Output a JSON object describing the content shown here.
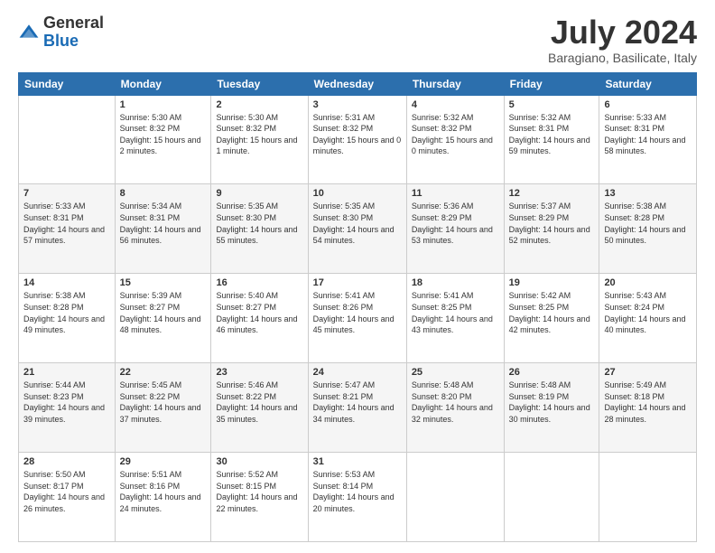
{
  "logo": {
    "general": "General",
    "blue": "Blue"
  },
  "header": {
    "month": "July 2024",
    "location": "Baragiano, Basilicate, Italy"
  },
  "days_of_week": [
    "Sunday",
    "Monday",
    "Tuesday",
    "Wednesday",
    "Thursday",
    "Friday",
    "Saturday"
  ],
  "weeks": [
    [
      {
        "day": "",
        "sunrise": "",
        "sunset": "",
        "daylight": ""
      },
      {
        "day": "1",
        "sunrise": "Sunrise: 5:30 AM",
        "sunset": "Sunset: 8:32 PM",
        "daylight": "Daylight: 15 hours and 2 minutes."
      },
      {
        "day": "2",
        "sunrise": "Sunrise: 5:30 AM",
        "sunset": "Sunset: 8:32 PM",
        "daylight": "Daylight: 15 hours and 1 minute."
      },
      {
        "day": "3",
        "sunrise": "Sunrise: 5:31 AM",
        "sunset": "Sunset: 8:32 PM",
        "daylight": "Daylight: 15 hours and 0 minutes."
      },
      {
        "day": "4",
        "sunrise": "Sunrise: 5:32 AM",
        "sunset": "Sunset: 8:32 PM",
        "daylight": "Daylight: 15 hours and 0 minutes."
      },
      {
        "day": "5",
        "sunrise": "Sunrise: 5:32 AM",
        "sunset": "Sunset: 8:31 PM",
        "daylight": "Daylight: 14 hours and 59 minutes."
      },
      {
        "day": "6",
        "sunrise": "Sunrise: 5:33 AM",
        "sunset": "Sunset: 8:31 PM",
        "daylight": "Daylight: 14 hours and 58 minutes."
      }
    ],
    [
      {
        "day": "7",
        "sunrise": "Sunrise: 5:33 AM",
        "sunset": "Sunset: 8:31 PM",
        "daylight": "Daylight: 14 hours and 57 minutes."
      },
      {
        "day": "8",
        "sunrise": "Sunrise: 5:34 AM",
        "sunset": "Sunset: 8:31 PM",
        "daylight": "Daylight: 14 hours and 56 minutes."
      },
      {
        "day": "9",
        "sunrise": "Sunrise: 5:35 AM",
        "sunset": "Sunset: 8:30 PM",
        "daylight": "Daylight: 14 hours and 55 minutes."
      },
      {
        "day": "10",
        "sunrise": "Sunrise: 5:35 AM",
        "sunset": "Sunset: 8:30 PM",
        "daylight": "Daylight: 14 hours and 54 minutes."
      },
      {
        "day": "11",
        "sunrise": "Sunrise: 5:36 AM",
        "sunset": "Sunset: 8:29 PM",
        "daylight": "Daylight: 14 hours and 53 minutes."
      },
      {
        "day": "12",
        "sunrise": "Sunrise: 5:37 AM",
        "sunset": "Sunset: 8:29 PM",
        "daylight": "Daylight: 14 hours and 52 minutes."
      },
      {
        "day": "13",
        "sunrise": "Sunrise: 5:38 AM",
        "sunset": "Sunset: 8:28 PM",
        "daylight": "Daylight: 14 hours and 50 minutes."
      }
    ],
    [
      {
        "day": "14",
        "sunrise": "Sunrise: 5:38 AM",
        "sunset": "Sunset: 8:28 PM",
        "daylight": "Daylight: 14 hours and 49 minutes."
      },
      {
        "day": "15",
        "sunrise": "Sunrise: 5:39 AM",
        "sunset": "Sunset: 8:27 PM",
        "daylight": "Daylight: 14 hours and 48 minutes."
      },
      {
        "day": "16",
        "sunrise": "Sunrise: 5:40 AM",
        "sunset": "Sunset: 8:27 PM",
        "daylight": "Daylight: 14 hours and 46 minutes."
      },
      {
        "day": "17",
        "sunrise": "Sunrise: 5:41 AM",
        "sunset": "Sunset: 8:26 PM",
        "daylight": "Daylight: 14 hours and 45 minutes."
      },
      {
        "day": "18",
        "sunrise": "Sunrise: 5:41 AM",
        "sunset": "Sunset: 8:25 PM",
        "daylight": "Daylight: 14 hours and 43 minutes."
      },
      {
        "day": "19",
        "sunrise": "Sunrise: 5:42 AM",
        "sunset": "Sunset: 8:25 PM",
        "daylight": "Daylight: 14 hours and 42 minutes."
      },
      {
        "day": "20",
        "sunrise": "Sunrise: 5:43 AM",
        "sunset": "Sunset: 8:24 PM",
        "daylight": "Daylight: 14 hours and 40 minutes."
      }
    ],
    [
      {
        "day": "21",
        "sunrise": "Sunrise: 5:44 AM",
        "sunset": "Sunset: 8:23 PM",
        "daylight": "Daylight: 14 hours and 39 minutes."
      },
      {
        "day": "22",
        "sunrise": "Sunrise: 5:45 AM",
        "sunset": "Sunset: 8:22 PM",
        "daylight": "Daylight: 14 hours and 37 minutes."
      },
      {
        "day": "23",
        "sunrise": "Sunrise: 5:46 AM",
        "sunset": "Sunset: 8:22 PM",
        "daylight": "Daylight: 14 hours and 35 minutes."
      },
      {
        "day": "24",
        "sunrise": "Sunrise: 5:47 AM",
        "sunset": "Sunset: 8:21 PM",
        "daylight": "Daylight: 14 hours and 34 minutes."
      },
      {
        "day": "25",
        "sunrise": "Sunrise: 5:48 AM",
        "sunset": "Sunset: 8:20 PM",
        "daylight": "Daylight: 14 hours and 32 minutes."
      },
      {
        "day": "26",
        "sunrise": "Sunrise: 5:48 AM",
        "sunset": "Sunset: 8:19 PM",
        "daylight": "Daylight: 14 hours and 30 minutes."
      },
      {
        "day": "27",
        "sunrise": "Sunrise: 5:49 AM",
        "sunset": "Sunset: 8:18 PM",
        "daylight": "Daylight: 14 hours and 28 minutes."
      }
    ],
    [
      {
        "day": "28",
        "sunrise": "Sunrise: 5:50 AM",
        "sunset": "Sunset: 8:17 PM",
        "daylight": "Daylight: 14 hours and 26 minutes."
      },
      {
        "day": "29",
        "sunrise": "Sunrise: 5:51 AM",
        "sunset": "Sunset: 8:16 PM",
        "daylight": "Daylight: 14 hours and 24 minutes."
      },
      {
        "day": "30",
        "sunrise": "Sunrise: 5:52 AM",
        "sunset": "Sunset: 8:15 PM",
        "daylight": "Daylight: 14 hours and 22 minutes."
      },
      {
        "day": "31",
        "sunrise": "Sunrise: 5:53 AM",
        "sunset": "Sunset: 8:14 PM",
        "daylight": "Daylight: 14 hours and 20 minutes."
      },
      {
        "day": "",
        "sunrise": "",
        "sunset": "",
        "daylight": ""
      },
      {
        "day": "",
        "sunrise": "",
        "sunset": "",
        "daylight": ""
      },
      {
        "day": "",
        "sunrise": "",
        "sunset": "",
        "daylight": ""
      }
    ]
  ]
}
